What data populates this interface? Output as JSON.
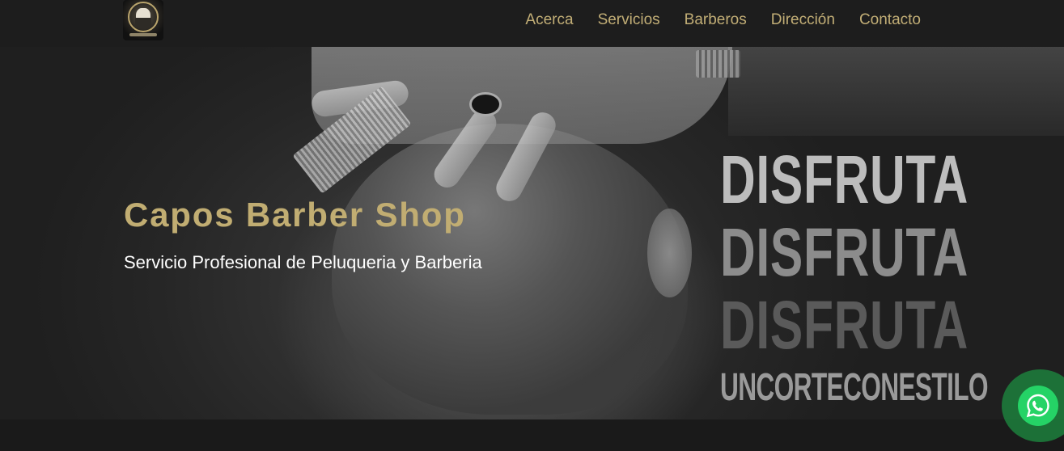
{
  "brand": {
    "name": "Capos Barber Shop logo"
  },
  "nav": {
    "items": [
      {
        "label": "Acerca"
      },
      {
        "label": "Servicios"
      },
      {
        "label": "Barberos"
      },
      {
        "label": "Dirección"
      },
      {
        "label": "Contacto"
      }
    ]
  },
  "hero": {
    "title": "Capos Barber Shop",
    "subtitle": "Servicio Profesional de Peluqueria y Barberia",
    "slogan": {
      "word": "DISFRUTA",
      "tagline": "UNCORTECONESTILO"
    }
  },
  "whatsapp": {
    "icon": "whatsapp-icon"
  },
  "colors": {
    "accent": "#c1ad72",
    "navbar": "#1d1d1d",
    "whatsapp": "#25d366"
  }
}
